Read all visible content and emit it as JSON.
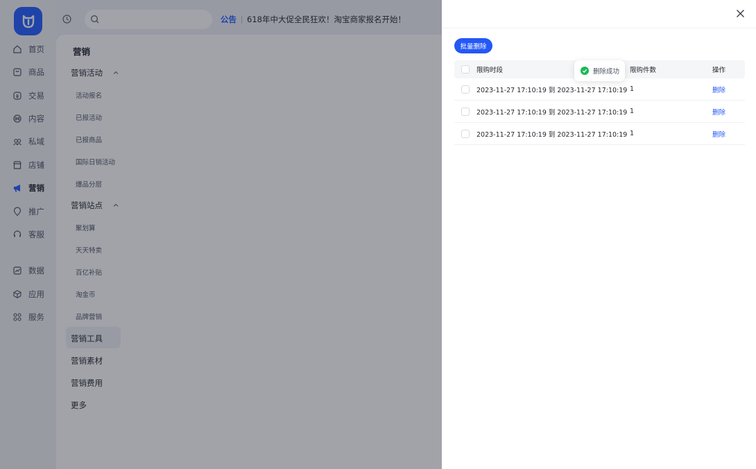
{
  "colors": {
    "brand": "#1f5aff",
    "primary_button": "#2458f5",
    "success": "#19b955"
  },
  "rail": {
    "items": [
      {
        "label": "首页",
        "icon": "home-icon"
      },
      {
        "label": "商品",
        "icon": "goods-icon"
      },
      {
        "label": "交易",
        "icon": "trade-icon"
      },
      {
        "label": "内容",
        "icon": "content-icon"
      },
      {
        "label": "私域",
        "icon": "private-domain-icon"
      },
      {
        "label": "店铺",
        "icon": "store-icon"
      },
      {
        "label": "营销",
        "icon": "megaphone-icon",
        "active": true
      },
      {
        "label": "推广",
        "icon": "promotion-icon"
      },
      {
        "label": "客服",
        "icon": "headset-icon"
      },
      {
        "label": "数据",
        "icon": "chart-icon"
      },
      {
        "label": "应用",
        "icon": "apps-icon"
      },
      {
        "label": "服务",
        "icon": "grid-icon"
      }
    ]
  },
  "topbar": {
    "notice_tag": "公告",
    "notice_text": "618年中大促全民狂欢！淘宝商家报名开始！"
  },
  "subnav": {
    "title": "营销",
    "groups": [
      {
        "label": "营销活动",
        "items": [
          "活动报名",
          "已报活动",
          "已报商品",
          "国际日销活动",
          "爆品分层"
        ]
      },
      {
        "label": "营销站点",
        "items": [
          "聚划算",
          "天天特卖",
          "百亿补贴",
          "淘金币",
          "品牌营销"
        ]
      }
    ],
    "top_items": [
      "营销工具",
      "营销素材",
      "营销费用",
      "更多"
    ]
  },
  "drawer": {
    "batch_delete_label": "批量删除",
    "columns": {
      "period": "限购时段",
      "qty": "限购件数",
      "op": "操作"
    },
    "rows": [
      {
        "period": "2023-11-27 17:10:19 到 2023-11-27 17:10:19",
        "qty": "1",
        "op": "删除"
      },
      {
        "period": "2023-11-27 17:10:19 到 2023-11-27 17:10:19",
        "qty": "1",
        "op": "删除"
      },
      {
        "period": "2023-11-27 17:10:19 到 2023-11-27 17:10:19",
        "qty": "1",
        "op": "删除"
      }
    ],
    "toast": "删除成功"
  }
}
